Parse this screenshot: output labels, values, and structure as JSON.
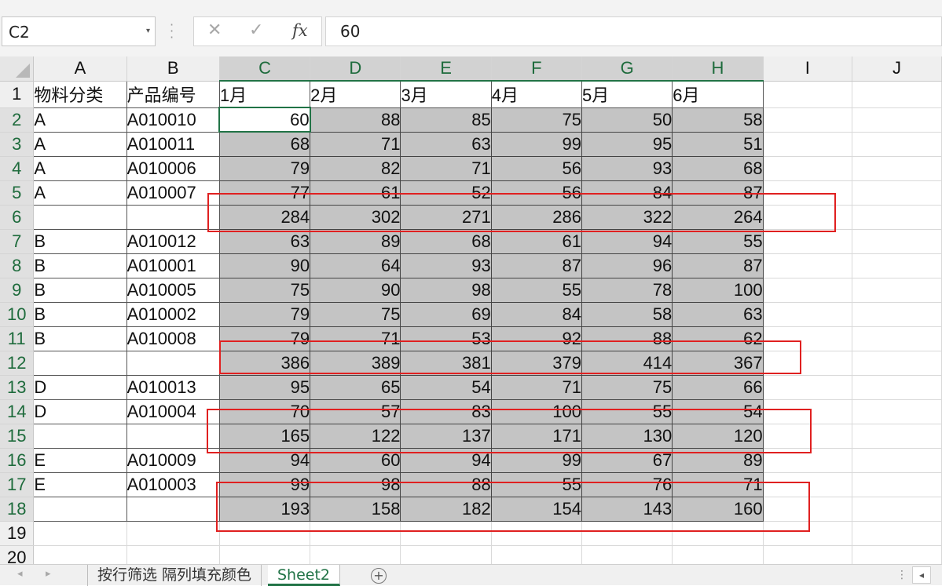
{
  "formula_bar": {
    "name_box": "C2",
    "name_box_arrow": "▾",
    "cancel": "✕",
    "enter": "✓",
    "fx": "fx",
    "value": "60"
  },
  "columns": [
    "A",
    "B",
    "C",
    "D",
    "E",
    "F",
    "G",
    "H",
    "I",
    "J"
  ],
  "selected_columns": [
    "C",
    "D",
    "E",
    "F",
    "G",
    "H"
  ],
  "row_numbers": [
    "1",
    "2",
    "3",
    "4",
    "5",
    "6",
    "7",
    "8",
    "9",
    "10",
    "11",
    "12",
    "13",
    "14",
    "15",
    "16",
    "17",
    "18",
    "19",
    "20"
  ],
  "header_row": [
    "物料分类",
    "产品编号",
    "1月",
    "2月",
    "3月",
    "4月",
    "5月",
    "6月"
  ],
  "data_rows": [
    {
      "cat": "A",
      "code": "A010010",
      "values": [
        "60",
        "88",
        "85",
        "75",
        "50",
        "58"
      ]
    },
    {
      "cat": "A",
      "code": "A010011",
      "values": [
        "68",
        "71",
        "63",
        "99",
        "95",
        "51"
      ]
    },
    {
      "cat": "A",
      "code": "A010006",
      "values": [
        "79",
        "82",
        "71",
        "56",
        "93",
        "68"
      ]
    },
    {
      "cat": "A",
      "code": "A010007",
      "values": [
        "77",
        "61",
        "52",
        "56",
        "84",
        "87"
      ]
    },
    {
      "cat": "",
      "code": "",
      "values": [
        "284",
        "302",
        "271",
        "286",
        "322",
        "264"
      ]
    },
    {
      "cat": "B",
      "code": "A010012",
      "values": [
        "63",
        "89",
        "68",
        "61",
        "94",
        "55"
      ]
    },
    {
      "cat": "B",
      "code": "A010001",
      "values": [
        "90",
        "64",
        "93",
        "87",
        "96",
        "87"
      ]
    },
    {
      "cat": "B",
      "code": "A010005",
      "values": [
        "75",
        "90",
        "98",
        "55",
        "78",
        "100"
      ]
    },
    {
      "cat": "B",
      "code": "A010002",
      "values": [
        "79",
        "75",
        "69",
        "84",
        "58",
        "63"
      ]
    },
    {
      "cat": "B",
      "code": "A010008",
      "values": [
        "79",
        "71",
        "53",
        "92",
        "88",
        "62"
      ]
    },
    {
      "cat": "",
      "code": "",
      "values": [
        "386",
        "389",
        "381",
        "379",
        "414",
        "367"
      ]
    },
    {
      "cat": "D",
      "code": "A010013",
      "values": [
        "95",
        "65",
        "54",
        "71",
        "75",
        "66"
      ]
    },
    {
      "cat": "D",
      "code": "A010004",
      "values": [
        "70",
        "57",
        "83",
        "100",
        "55",
        "54"
      ]
    },
    {
      "cat": "",
      "code": "",
      "values": [
        "165",
        "122",
        "137",
        "171",
        "130",
        "120"
      ]
    },
    {
      "cat": "E",
      "code": "A010009",
      "values": [
        "94",
        "60",
        "94",
        "99",
        "67",
        "89"
      ]
    },
    {
      "cat": "E",
      "code": "A010003",
      "values": [
        "99",
        "98",
        "88",
        "55",
        "76",
        "71"
      ]
    },
    {
      "cat": "",
      "code": "",
      "values": [
        "193",
        "158",
        "182",
        "154",
        "143",
        "160"
      ]
    }
  ],
  "sheet_tabs": {
    "nav_prev": "◂",
    "nav_next": "▸",
    "tabs": [
      {
        "label": "按行筛选 隔列填充颜色",
        "active": false
      },
      {
        "label": "Sheet2",
        "active": true
      }
    ],
    "add": "+",
    "menu_dots": "⋮",
    "scroll_left": "◂"
  },
  "colors": {
    "accent_green": "#217346",
    "selection_gray": "#c4c4c4",
    "highlight_red": "#e02020"
  }
}
